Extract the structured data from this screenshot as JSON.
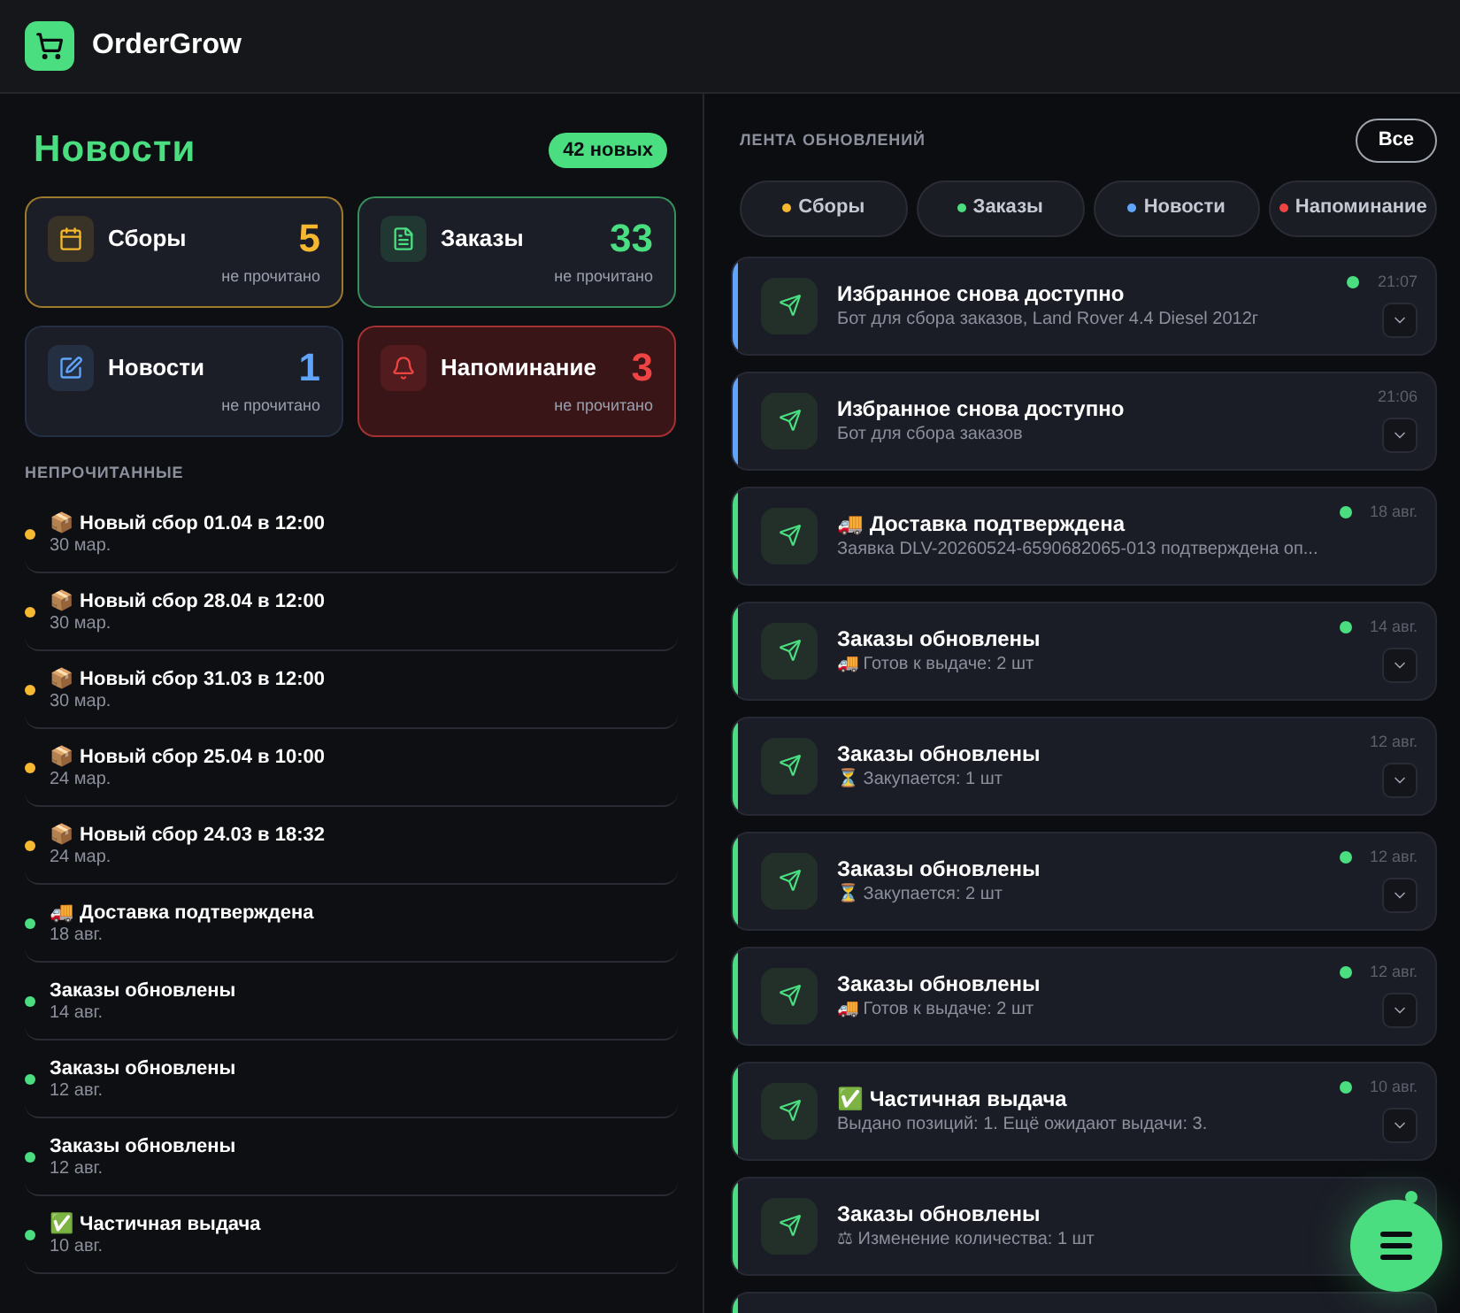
{
  "app": {
    "name": "OrderGrow"
  },
  "news": {
    "title": "Новости",
    "badge": "42 новых",
    "stats": [
      {
        "kind": "collections",
        "label": "Сборы",
        "count": "5",
        "caption": "не прочитано",
        "color": "#f5b82e"
      },
      {
        "kind": "orders",
        "label": "Заказы",
        "count": "33",
        "caption": "не прочитано",
        "color": "#4ade80"
      },
      {
        "kind": "news",
        "label": "Новости",
        "count": "1",
        "caption": "не прочитано",
        "color": "#60a5fa"
      },
      {
        "kind": "reminder",
        "label": "Напоминание",
        "count": "3",
        "caption": "не прочитано",
        "color": "#ef4444"
      }
    ],
    "unread_heading": "НЕПРОЧИТАННЫЕ",
    "unread": [
      {
        "title": "📦 Новый сбор 01.04 в 12:00",
        "date": "30 мар.",
        "color": "#f5b82e"
      },
      {
        "title": "📦 Новый сбор 28.04 в 12:00",
        "date": "30 мар.",
        "color": "#f5b82e"
      },
      {
        "title": "📦 Новый сбор 31.03 в 12:00",
        "date": "30 мар.",
        "color": "#f5b82e"
      },
      {
        "title": "📦 Новый сбор 25.04 в 10:00",
        "date": "24 мар.",
        "color": "#f5b82e"
      },
      {
        "title": "📦 Новый сбор 24.03 в 18:32",
        "date": "24 мар.",
        "color": "#f5b82e"
      },
      {
        "title": "🚚 Доставка подтверждена",
        "date": "18 авг.",
        "color": "#4ade80"
      },
      {
        "title": "Заказы обновлены",
        "date": "14 авг.",
        "color": "#4ade80"
      },
      {
        "title": "Заказы обновлены",
        "date": "12 авг.",
        "color": "#4ade80"
      },
      {
        "title": "Заказы обновлены",
        "date": "12 авг.",
        "color": "#4ade80"
      },
      {
        "title": "✅ Частичная выдача",
        "date": "10 авг.",
        "color": "#4ade80"
      }
    ]
  },
  "feed": {
    "title": "ЛЕНТА ОБНОВЛЕНИЙ",
    "all_button": "Все",
    "filters": [
      {
        "label": "Сборы",
        "color": "#f5b82e"
      },
      {
        "label": "Заказы",
        "color": "#4ade80"
      },
      {
        "label": "Новости",
        "color": "#60a5fa"
      },
      {
        "label": "Напоминание",
        "color": "#ef4444"
      }
    ],
    "items": [
      {
        "title": "Избранное снова доступно",
        "text": "Бот для сбора заказов, Land Rover 4.4 Diesel 2012г",
        "time": "21:07",
        "unread": true,
        "expandable": true,
        "color": "#60a5fa"
      },
      {
        "title": "Избранное снова доступно",
        "text": "Бот для сбора заказов",
        "time": "21:06",
        "unread": false,
        "expandable": true,
        "color": "#60a5fa"
      },
      {
        "title": "🚚 Доставка подтверждена",
        "text": "Заявка DLV-20260524-6590682065-013 подтверждена оп...",
        "time": "18 авг.",
        "unread": true,
        "expandable": false,
        "color": "#4ade80"
      },
      {
        "title": "Заказы обновлены",
        "text": "🚚 Готов к выдаче: 2 шт",
        "time": "14 авг.",
        "unread": true,
        "expandable": true,
        "color": "#4ade80"
      },
      {
        "title": "Заказы обновлены",
        "text": "⏳ Закупается: 1 шт",
        "time": "12 авг.",
        "unread": false,
        "expandable": true,
        "color": "#4ade80"
      },
      {
        "title": "Заказы обновлены",
        "text": "⏳ Закупается: 2 шт",
        "time": "12 авг.",
        "unread": true,
        "expandable": true,
        "color": "#4ade80"
      },
      {
        "title": "Заказы обновлены",
        "text": "🚚 Готов к выдаче: 2 шт",
        "time": "12 авг.",
        "unread": true,
        "expandable": true,
        "color": "#4ade80"
      },
      {
        "title": "✅ Частичная выдача",
        "text": "Выдано позиций: 1. Ещё ожидают выдачи: 3.",
        "time": "10 авг.",
        "unread": true,
        "expandable": true,
        "color": "#4ade80"
      },
      {
        "title": "Заказы обновлены",
        "text": "⚖ Изменение количества: 1 шт",
        "unread": true,
        "expandable": false,
        "color": "#4ade80"
      },
      {
        "color": "#4ade80"
      }
    ]
  }
}
